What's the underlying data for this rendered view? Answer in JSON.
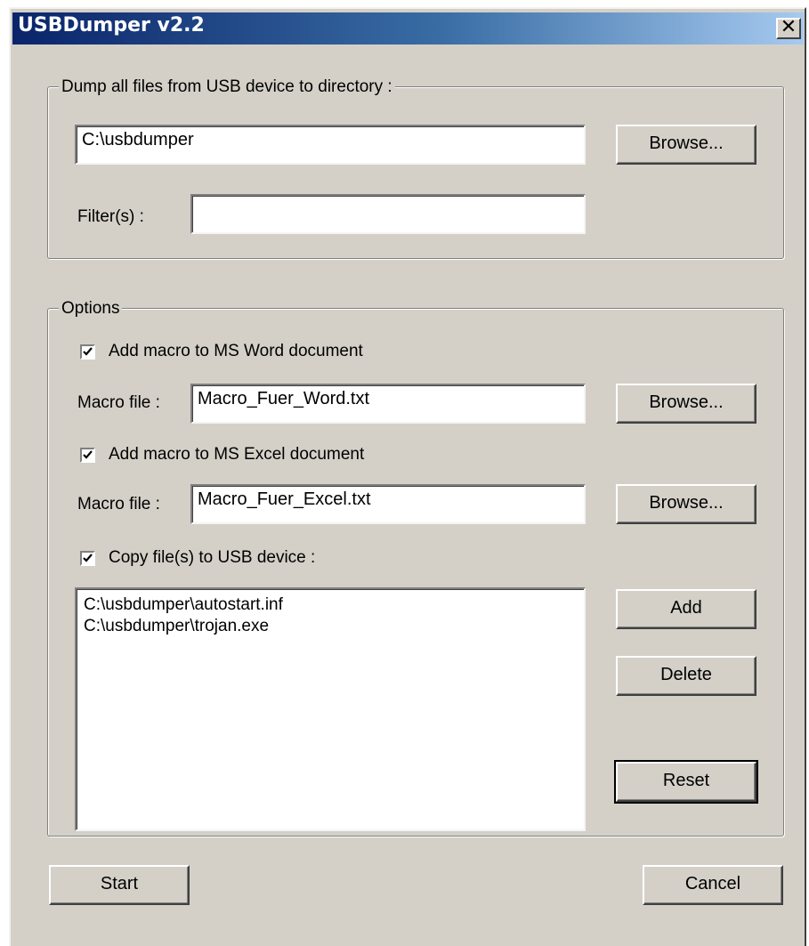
{
  "window": {
    "title": "USBDumper v2.2",
    "close_glyph": "✕"
  },
  "dump_group": {
    "label": "Dump all files from USB device to directory :",
    "directory_value": "C:\\usbdumper",
    "browse_label": "Browse...",
    "filter_label": "Filter(s) :",
    "filter_value": ""
  },
  "options": {
    "label": "Options",
    "word": {
      "checkbox_label": "Add macro to MS Word document",
      "checked": true,
      "macro_label": "Macro file :",
      "macro_value": "Macro_Fuer_Word.txt",
      "browse_label": "Browse..."
    },
    "excel": {
      "checkbox_label": "Add macro to MS Excel document",
      "checked": true,
      "macro_label": "Macro file :",
      "macro_value": "Macro_Fuer_Excel.txt",
      "browse_label": "Browse..."
    },
    "copy": {
      "checkbox_label": "Copy file(s) to USB device :",
      "checked": true,
      "files": [
        "C:\\usbdumper\\autostart.inf",
        "C:\\usbdumper\\trojan.exe"
      ],
      "add_label": "Add",
      "delete_label": "Delete",
      "reset_label": "Reset"
    }
  },
  "footer": {
    "start_label": "Start",
    "cancel_label": "Cancel"
  }
}
